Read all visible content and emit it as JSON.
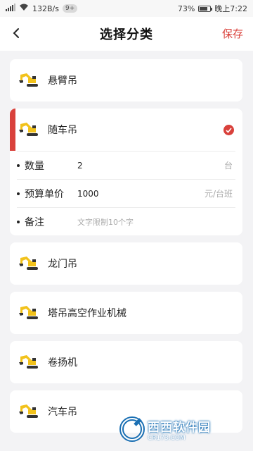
{
  "status_bar": {
    "speed": "132B/s",
    "badge": "9+",
    "battery": "73%",
    "time": "晚上7:22",
    "battery_level": 0.73
  },
  "header": {
    "title": "选择分类",
    "save_label": "保存",
    "back_icon": "chevron-left-icon"
  },
  "categories": [
    {
      "label": "悬臂吊",
      "icon": "excavator-icon",
      "selected": false
    },
    {
      "label": "随车吊",
      "icon": "excavator-icon",
      "selected": true
    },
    {
      "label": "龙门吊",
      "icon": "excavator-icon",
      "selected": false
    },
    {
      "label": "塔吊高空作业机械",
      "icon": "excavator-icon",
      "selected": false
    },
    {
      "label": "卷扬机",
      "icon": "excavator-icon",
      "selected": false
    },
    {
      "label": "汽车吊",
      "icon": "excavator-icon",
      "selected": false
    }
  ],
  "selected_details": {
    "quantity": {
      "label": "数量",
      "value": "2",
      "unit": "台"
    },
    "budget": {
      "label": "预算单价",
      "value": "1000",
      "unit": "元/台班"
    },
    "note": {
      "label": "备注",
      "placeholder": "文字限制10个字"
    }
  },
  "watermark": {
    "text": "西西软件园",
    "url": "CR173.COM"
  },
  "colors": {
    "accent": "#d9413b",
    "background": "#f3f3f5",
    "card": "#ffffff",
    "excavator_body": "#f2c21b"
  }
}
